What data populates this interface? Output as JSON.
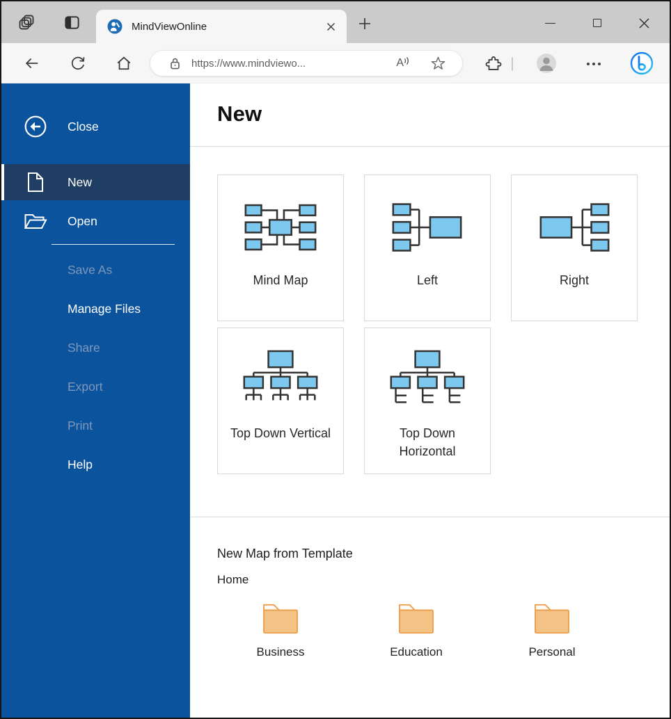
{
  "window": {
    "controls": {
      "minimize": "minimize-button",
      "maximize": "maximize-button",
      "close": "close-button"
    }
  },
  "tab_strip": {
    "active_tab": {
      "title": "MindViewOnline",
      "favicon": "mindview-logo-icon",
      "close_icon": "✕"
    },
    "left_buttons": [
      "workspaces-icon",
      "vertical-tabs-icon"
    ],
    "new_tab_icon": "plus-icon"
  },
  "toolbar": {
    "nav_icons": [
      "back-icon",
      "refresh-icon",
      "home-icon"
    ],
    "address": {
      "security_icon": "lock-icon",
      "url": "https://www.mindviewo...",
      "read_aloud_label": "A",
      "favorite_icon": "star-icon"
    },
    "right_icons": [
      "extensions-puzzle-icon",
      "profile-avatar",
      "more-dots-icon",
      "bing-chat-icon"
    ]
  },
  "sidebar": {
    "items": [
      {
        "label": "Close",
        "icon": "back-circle-icon",
        "state": "normal"
      },
      {
        "label": "New",
        "icon": "document-icon",
        "state": "active"
      },
      {
        "label": "Open",
        "icon": "open-folder-icon",
        "state": "normal"
      },
      {
        "label": "Save As",
        "state": "disabled"
      },
      {
        "label": "Manage Files",
        "state": "normal"
      },
      {
        "label": "Share",
        "state": "disabled"
      },
      {
        "label": "Export",
        "state": "disabled"
      },
      {
        "label": "Print",
        "state": "disabled"
      },
      {
        "label": "Help",
        "state": "normal"
      }
    ]
  },
  "main": {
    "heading": "New",
    "templates": [
      {
        "label": "Mind Map",
        "icon": "mind-map-diagram"
      },
      {
        "label": "Left",
        "icon": "left-diagram"
      },
      {
        "label": "Right",
        "icon": "right-diagram"
      },
      {
        "label": "Top Down Vertical",
        "icon": "top-down-vertical-diagram"
      },
      {
        "label": "Top Down Horizontal",
        "icon": "top-down-horizontal-diagram"
      }
    ],
    "from_template": {
      "title": "New Map from Template",
      "group_label": "Home",
      "folders": [
        {
          "label": "Business",
          "icon": "folder-icon"
        },
        {
          "label": "Education",
          "icon": "folder-icon"
        },
        {
          "label": "Personal",
          "icon": "folder-icon"
        }
      ]
    }
  },
  "colors": {
    "sidebar_blue": "#0b549d",
    "sidebar_active": "#203e63",
    "disabled_text": "#7d98bb",
    "diagram_fill": "#7dc8ee",
    "diagram_stroke": "#333333",
    "folder_fill": "#f2c385",
    "folder_stroke": "#eda04f",
    "tabstrip_bg": "#cbcbcb",
    "chrome_bg": "#f6f6f6"
  }
}
